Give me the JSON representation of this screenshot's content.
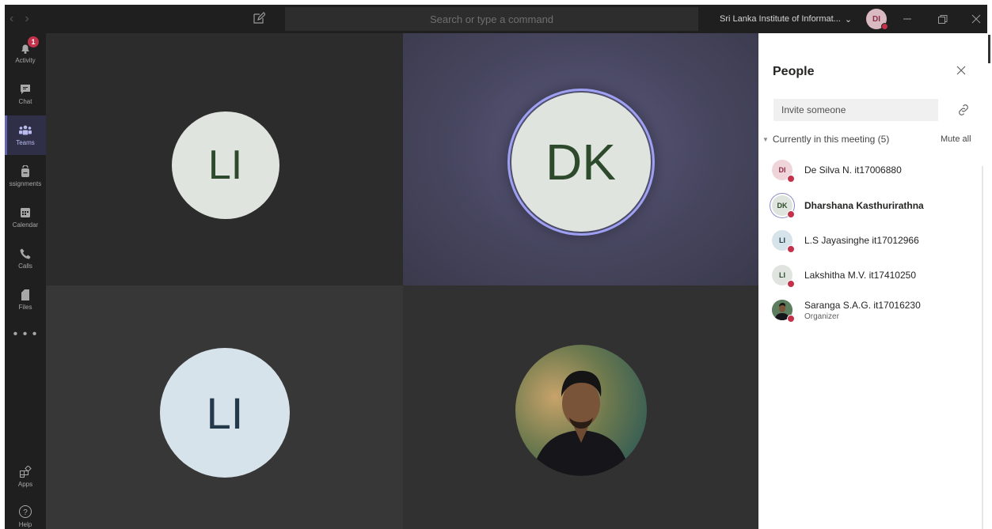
{
  "titlebar": {
    "search_placeholder": "Search or type a command",
    "org_name": "Sri Lanka Institute of Informat...",
    "user_initials": "DI"
  },
  "rail": {
    "items": [
      {
        "label": "Activity",
        "badge": "1"
      },
      {
        "label": "Chat"
      },
      {
        "label": "Teams"
      },
      {
        "label": "ssignments"
      },
      {
        "label": "Calendar"
      },
      {
        "label": "Calls"
      },
      {
        "label": "Files"
      },
      {
        "label": "Apps"
      },
      {
        "label": "Help"
      }
    ],
    "more": "• • •"
  },
  "tiles": [
    {
      "initials": "LI"
    },
    {
      "initials": "DK"
    },
    {
      "initials": "LI"
    }
  ],
  "people_panel": {
    "title": "People",
    "invite_placeholder": "Invite someone",
    "section_label": "Currently in this meeting (5)",
    "mute_all": "Mute all",
    "participants": [
      {
        "initials": "DI",
        "name": "De Silva N. it17006880",
        "avatar_bg": "#efd5da",
        "avatar_fg": "#8a2d45"
      },
      {
        "initials": "DK",
        "name": "Dharshana Kasthurirathna",
        "avatar_bg": "#dfe5de",
        "avatar_fg": "#2e4a2c"
      },
      {
        "initials": "LI",
        "name": "L.S Jayasinghe it17012966",
        "avatar_bg": "#d7e3ea",
        "avatar_fg": "#24394a"
      },
      {
        "initials": "LI",
        "name": "Lakshitha M.V. it17410250",
        "avatar_bg": "#dfe5de",
        "avatar_fg": "#2e4a2c"
      },
      {
        "initials": "",
        "name": "Saranga S.A.G. it17016230",
        "role": "Organizer"
      }
    ]
  },
  "colors": {
    "accent": "#6264a7",
    "status_busy": "#c4314b",
    "rail_bg": "#1f1f1f"
  }
}
